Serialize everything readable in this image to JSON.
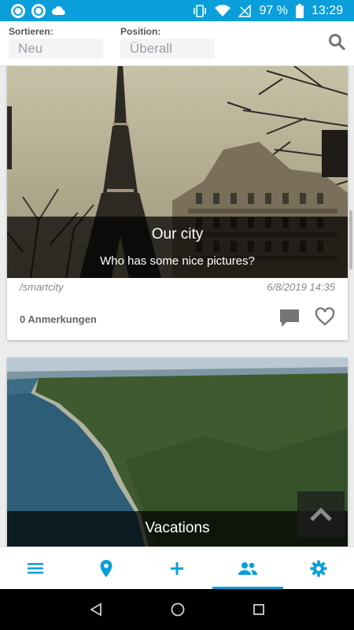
{
  "status_bar": {
    "battery": "97 %",
    "time": "13:29"
  },
  "filters": {
    "sort_label": "Sortieren:",
    "sort_value": "Neu",
    "position_label": "Position:",
    "position_value": "Überall"
  },
  "cards": [
    {
      "title": "Our city",
      "subtitle": "Who has some nice pictures?",
      "tag": "/smartcity",
      "date": "6/8/2019 14:35",
      "comments": "0 Anmerkungen"
    },
    {
      "title": "Vacations"
    }
  ],
  "bottom_nav": {
    "items": [
      "list-icon",
      "location-pin-icon",
      "add-icon",
      "group-icon",
      "settings-icon"
    ],
    "active_index": 3
  },
  "colors": {
    "accent": "#0a9fdb",
    "status_bar": "#0a9fdb"
  }
}
